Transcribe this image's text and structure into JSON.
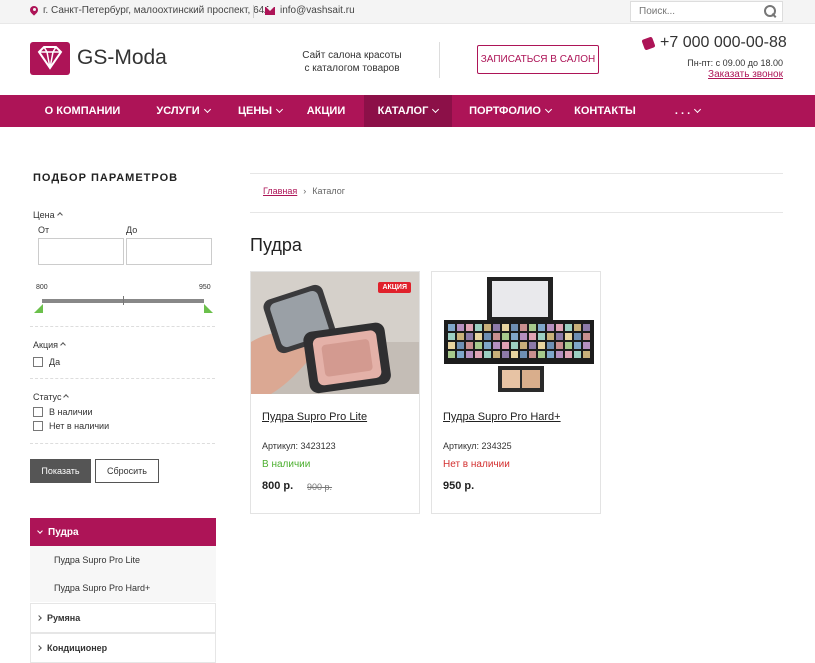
{
  "topbar": {
    "address": "г. Санкт-Петербург, малоохтинский проспект, 64А",
    "email": "info@vashsait.ru",
    "search_placeholder": "Поиск..."
  },
  "header": {
    "logo": "GS-Moda",
    "tagline_line1": "Сайт салона красоты",
    "tagline_line2": "с каталогом товаров",
    "book_button": "ЗАПИСАТЬСЯ В САЛОН",
    "phone": "+7 000 000-00-88",
    "hours": "Пн-пт: с 09.00 до 18.00",
    "callback": "Заказать звонок"
  },
  "nav": {
    "items": [
      {
        "label": "О КОМПАНИИ",
        "chevron": false
      },
      {
        "label": "УСЛУГИ",
        "chevron": true
      },
      {
        "label": "ЦЕНЫ",
        "chevron": true
      },
      {
        "label": "АКЦИИ",
        "chevron": false
      },
      {
        "label": "КАТАЛОГ",
        "chevron": true,
        "active": true
      },
      {
        "label": "ПОРТФОЛИО",
        "chevron": true
      },
      {
        "label": "КОНТАКТЫ",
        "chevron": false
      },
      {
        "label": ". . .",
        "chevron": true
      }
    ]
  },
  "filter": {
    "title": "ПОДБОР ПАРАМЕТРОВ",
    "price_label": "Цена",
    "from_label": "От",
    "to_label": "До",
    "range_min": "800",
    "range_max": "950",
    "promo_label": "Акция",
    "promo_yes": "Да",
    "status_label": "Статус",
    "in_stock": "В наличии",
    "out_of_stock": "Нет в наличии",
    "show_button": "Показать",
    "reset_button": "Сбросить"
  },
  "categories": {
    "active": "Пудра",
    "subitems": [
      "Пудра Supro Pro Lite",
      "Пудра Supro Pro Hard+"
    ],
    "items": [
      "Румяна",
      "Кондиционер"
    ]
  },
  "breadcrumb": {
    "home": "Главная",
    "current": "Каталог"
  },
  "page_title": "Пудра",
  "products": [
    {
      "name": "Пудра Supro Pro Lite",
      "badge": "АКЦИЯ",
      "sku": "Артикул: 3423123",
      "stock": "В наличии",
      "stock_color": "#4caf2f",
      "price": "800 р.",
      "old_price": "900 р."
    },
    {
      "name": "Пудра Supro Pro Hard+",
      "sku": "Артикул: 234325",
      "stock": "Нет в наличии",
      "stock_color": "#d32f2f",
      "price": "950 р."
    }
  ],
  "colors": {
    "accent": "#ad1457"
  }
}
